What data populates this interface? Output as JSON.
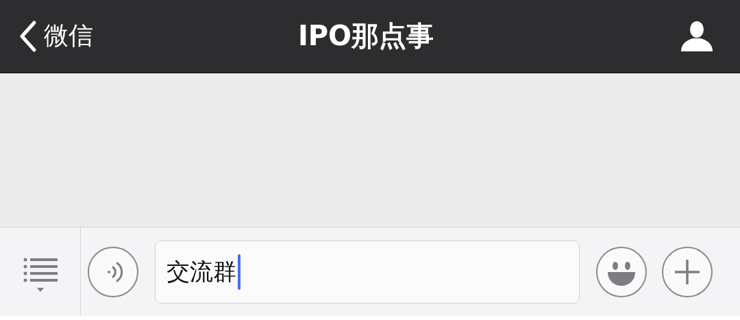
{
  "nav_bar": {
    "back_label": "微信",
    "title": "IPO那点事"
  },
  "input_bar": {
    "value": "交流群",
    "focused": true
  }
}
